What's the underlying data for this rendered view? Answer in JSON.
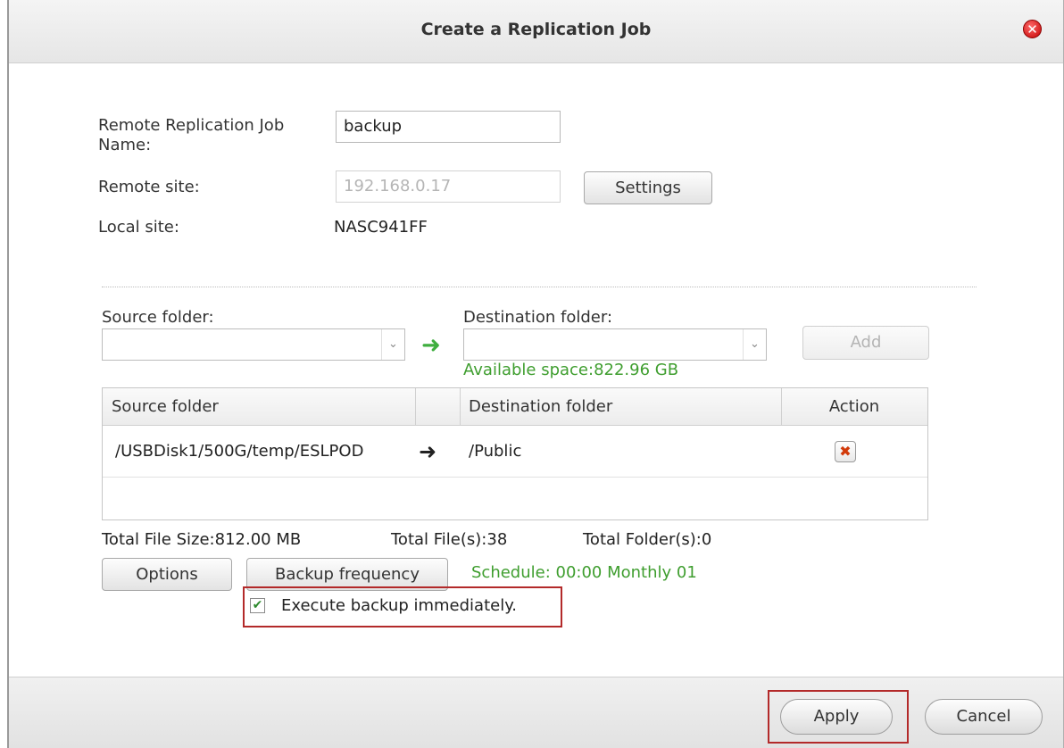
{
  "dialog": {
    "title": "Create a Replication Job",
    "close_icon": "close-icon"
  },
  "form": {
    "job_name_label_line1": "Remote Replication Job",
    "job_name_label_line2": "Name:",
    "job_name_value": "backup",
    "remote_site_label": "Remote site:",
    "remote_site_value": "192.168.0.17",
    "settings_button": "Settings",
    "local_site_label": "Local site:",
    "local_site_value": "NASC941FF"
  },
  "folders": {
    "source_label": "Source folder:",
    "source_value": "",
    "destination_label": "Destination folder:",
    "destination_value": "",
    "add_button": "Add",
    "available_space": "Available space:822.96 GB"
  },
  "table": {
    "headers": [
      "Source folder",
      "",
      "Destination folder",
      "Action"
    ],
    "rows": [
      {
        "source": "/USBDisk1/500G/temp/ESLPOD",
        "destination": "/Public",
        "action_icon": "delete-icon"
      }
    ]
  },
  "summary": {
    "total_size": "Total File Size:812.00 MB",
    "total_files": "Total File(s):38",
    "total_folders": "Total Folder(s):0"
  },
  "options": {
    "options_button": "Options",
    "frequency_button": "Backup frequency",
    "schedule": "Schedule: 00:00  Monthly 01",
    "execute_label": "Execute backup immediately.",
    "execute_checked": true
  },
  "footer": {
    "apply": "Apply",
    "cancel": "Cancel"
  },
  "colors": {
    "accent_green": "#3f9e2f",
    "highlight_red": "#b32a2a"
  }
}
